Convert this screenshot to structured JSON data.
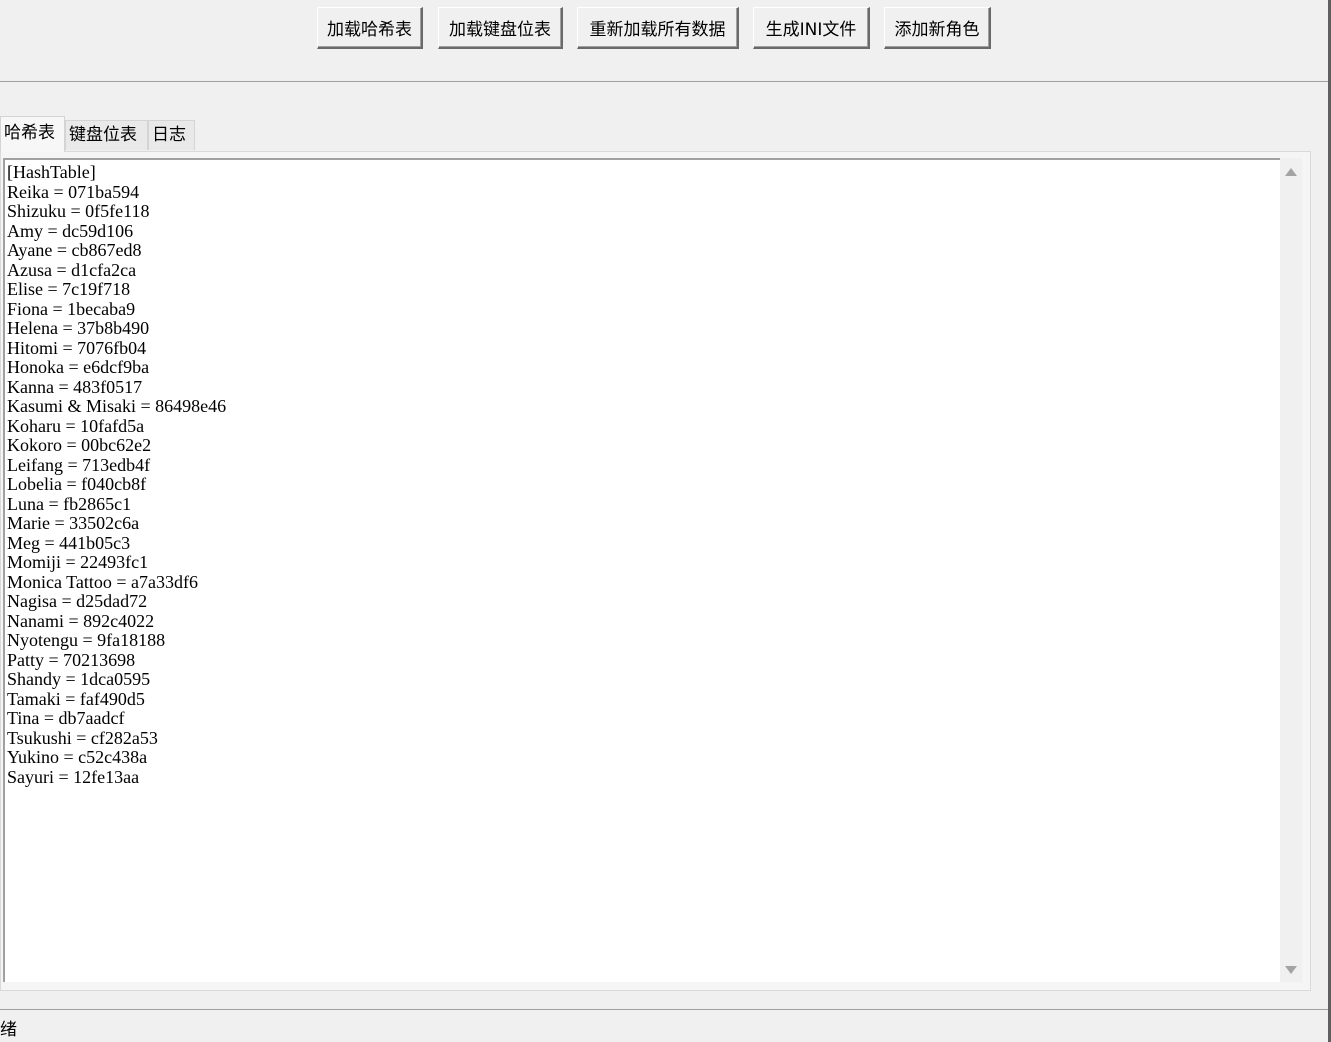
{
  "toolbar": {
    "buttons": [
      {
        "label": "加载哈希表"
      },
      {
        "label": "加载键盘位表"
      },
      {
        "label": "重新加载所有数据"
      },
      {
        "label": "生成INI文件"
      },
      {
        "label": "添加新角色"
      }
    ]
  },
  "tabs": [
    {
      "label": "哈希表"
    },
    {
      "label": "键盘位表"
    },
    {
      "label": "日志"
    }
  ],
  "editor": {
    "header": "[HashTable]",
    "entries": [
      "Reika = 071ba594",
      "Shizuku = 0f5fe118",
      "Amy = dc59d106",
      "Ayane = cb867ed8",
      "Azusa = d1cfa2ca",
      "Elise = 7c19f718",
      "Fiona = 1becaba9",
      "Helena = 37b8b490",
      "Hitomi = 7076fb04",
      "Honoka = e6dcf9ba",
      "Kanna = 483f0517",
      "Kasumi & Misaki = 86498e46",
      "Koharu = 10fafd5a",
      "Kokoro = 00bc62e2",
      "Leifang = 713edb4f",
      "Lobelia = f040cb8f",
      "Luna = fb2865c1",
      "Marie = 33502c6a",
      "Meg = 441b05c3",
      "Momiji = 22493fc1",
      "Monica Tattoo = a7a33df6",
      "Nagisa = d25dad72",
      "Nanami = 892c4022",
      "Nyotengu = 9fa18188",
      "Patty = 70213698",
      "Shandy = 1dca0595",
      "Tamaki = faf490d5",
      "Tina = db7aadcf",
      "Tsukushi = cf282a53",
      "Yukino = c52c438a",
      "Sayuri = 12fe13aa"
    ]
  },
  "status": {
    "text": "绪"
  }
}
